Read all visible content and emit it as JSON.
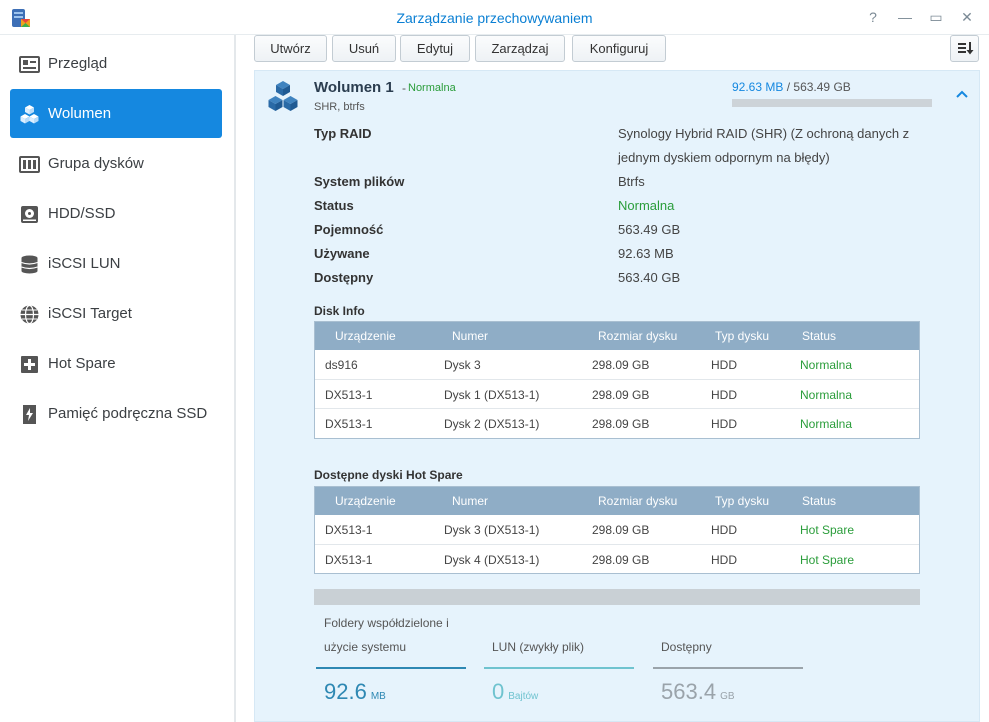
{
  "window": {
    "title": "Zarządzanie przechowywaniem",
    "help": "?",
    "minimize": "—",
    "maximize": "▭",
    "close": "✕"
  },
  "sidebar": {
    "items": [
      {
        "label": "Przegląd",
        "icon": "overview-icon",
        "active": false
      },
      {
        "label": "Wolumen",
        "icon": "volume-cubes-icon",
        "active": true
      },
      {
        "label": "Grupa dysków",
        "icon": "disk-group-icon",
        "active": false
      },
      {
        "label": "HDD/SSD",
        "icon": "hdd-icon",
        "active": false
      },
      {
        "label": "iSCSI LUN",
        "icon": "iscsi-lun-icon",
        "active": false
      },
      {
        "label": "iSCSI Target",
        "icon": "iscsi-target-icon",
        "active": false
      },
      {
        "label": "Hot Spare",
        "icon": "hot-spare-icon",
        "active": false
      },
      {
        "label": "Pamięć podręczna SSD",
        "icon": "ssd-cache-icon",
        "active": false
      }
    ]
  },
  "toolbar": {
    "create": "Utwórz",
    "delete": "Usuń",
    "edit": "Edytuj",
    "manage": "Zarządzaj",
    "configure": "Konfiguruj"
  },
  "volume": {
    "name": "Wolumen 1",
    "separator": "-",
    "status": "Normalna",
    "subtitle": "SHR, btrfs",
    "used": "92.63 MB",
    "usage_separator": "/",
    "total": "563.49 GB",
    "used_fraction": 0.0002,
    "properties": [
      {
        "key": "Typ RAID",
        "value": "Synology Hybrid RAID (SHR) (Z ochroną danych z jednym dyskiem odpornym na błędy)"
      },
      {
        "key": "System plików",
        "value": "Btrfs"
      },
      {
        "key": "Status",
        "value": "Normalna"
      },
      {
        "key": "Pojemność",
        "value": "563.49 GB"
      },
      {
        "key": "Używane",
        "value": "92.63 MB"
      },
      {
        "key": "Dostępny",
        "value": "563.40 GB"
      }
    ]
  },
  "disk_info": {
    "title": "Disk Info",
    "headers": [
      "Urządzenie",
      "Numer",
      "Rozmiar dysku",
      "Typ dysku",
      "Status"
    ],
    "rows": [
      [
        "ds916",
        "Dysk 3",
        "298.09 GB",
        "HDD",
        "Normalna"
      ],
      [
        "DX513-1",
        "Dysk 1 (DX513-1)",
        "298.09 GB",
        "HDD",
        "Normalna"
      ],
      [
        "DX513-1",
        "Dysk 2 (DX513-1)",
        "298.09 GB",
        "HDD",
        "Normalna"
      ]
    ]
  },
  "hot_spare": {
    "title": "Dostępne dyski Hot Spare",
    "headers": [
      "Urządzenie",
      "Numer",
      "Rozmiar dysku",
      "Typ dysku",
      "Status"
    ],
    "rows": [
      [
        "DX513-1",
        "Dysk 3 (DX513-1)",
        "298.09 GB",
        "HDD",
        "Hot Spare"
      ],
      [
        "DX513-1",
        "Dysk 4 (DX513-1)",
        "298.09 GB",
        "HDD",
        "Hot Spare"
      ]
    ]
  },
  "breakdown": [
    {
      "label_line1": "Foldery współdzielone i",
      "label_line2": "użycie systemu",
      "value": "92.6",
      "unit": "MB",
      "color": "#2e88b3"
    },
    {
      "label_line1": "",
      "label_line2": "LUN (zwykły plik)",
      "value": "0",
      "unit": "Bajtów",
      "color": "#6fc3cf"
    },
    {
      "label_line1": "",
      "label_line2": "Dostępny",
      "value": "563.4",
      "unit": "GB",
      "color": "#9aa3aa"
    }
  ],
  "colors": {
    "accent": "#1588e0",
    "title": "#0a7fd3",
    "ok": "#2a9d3a",
    "panel": "#e6f3fc",
    "table_header": "#8fadc6"
  }
}
